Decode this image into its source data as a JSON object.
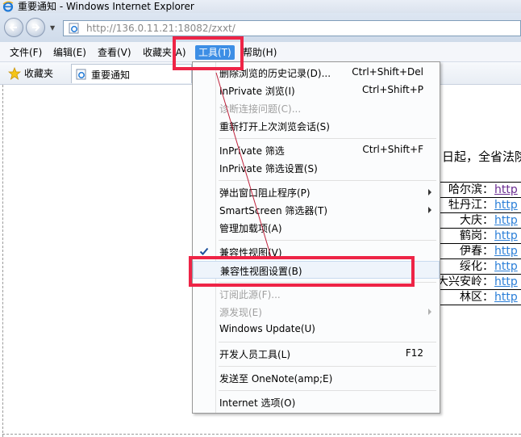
{
  "window": {
    "title": "重要通知 - Windows Internet Explorer"
  },
  "address": {
    "url": "http://136.0.11.21:18082/zxxt/"
  },
  "menubar": {
    "items": [
      {
        "label": "文件(F)"
      },
      {
        "label": "编辑(E)"
      },
      {
        "label": "查看(V)"
      },
      {
        "label": "收藏夹(A)"
      },
      {
        "label": "工具(T)"
      },
      {
        "label": "帮助(H)"
      }
    ]
  },
  "favbar": {
    "favorites_label": "收藏夹",
    "tab_label": "重要通知"
  },
  "content": {
    "intro_text": "日起，全省法院",
    "cities": [
      {
        "name": "哈尔滨：",
        "link": "http"
      },
      {
        "name": "牡丹江：",
        "link": "http"
      },
      {
        "name": "大庆：",
        "link": "http"
      },
      {
        "name": "鹤岗：",
        "link": "http"
      },
      {
        "name": "伊春：",
        "link": "http"
      },
      {
        "name": "绥化：",
        "link": "http"
      },
      {
        "name": "大兴安岭：",
        "link": "http"
      },
      {
        "name": "林区：",
        "link": "http"
      }
    ]
  },
  "tools_menu": {
    "items": [
      {
        "label": "删除浏览的历史记录(D)...",
        "shortcut": "Ctrl+Shift+Del"
      },
      {
        "label": "InPrivate 浏览(I)",
        "shortcut": "Ctrl+Shift+P"
      },
      {
        "label": "诊断连接问题(C)..."
      },
      {
        "label": "重新打开上次浏览会话(S)"
      },
      {
        "label": "InPrivate 筛选",
        "shortcut": "Ctrl+Shift+F"
      },
      {
        "label": "InPrivate 筛选设置(S)"
      },
      {
        "label": "弹出窗口阻止程序(P)"
      },
      {
        "label": "SmartScreen 筛选器(T)"
      },
      {
        "label": "管理加载项(A)"
      },
      {
        "label": "兼容性视图(V)"
      },
      {
        "label": "兼容性视图设置(B)"
      },
      {
        "label": "订阅此源(F)..."
      },
      {
        "label": "源发现(E)"
      },
      {
        "label": "Windows Update(U)"
      },
      {
        "label": "开发人员工具(L)",
        "shortcut": "F12"
      },
      {
        "label": "发送至 OneNote(amp;E)"
      },
      {
        "label": "Internet 选项(O)"
      }
    ]
  },
  "colors": {
    "highlight": "#ee2446",
    "active_menu": "#3d8ee5",
    "link": "#2b7fd8"
  }
}
